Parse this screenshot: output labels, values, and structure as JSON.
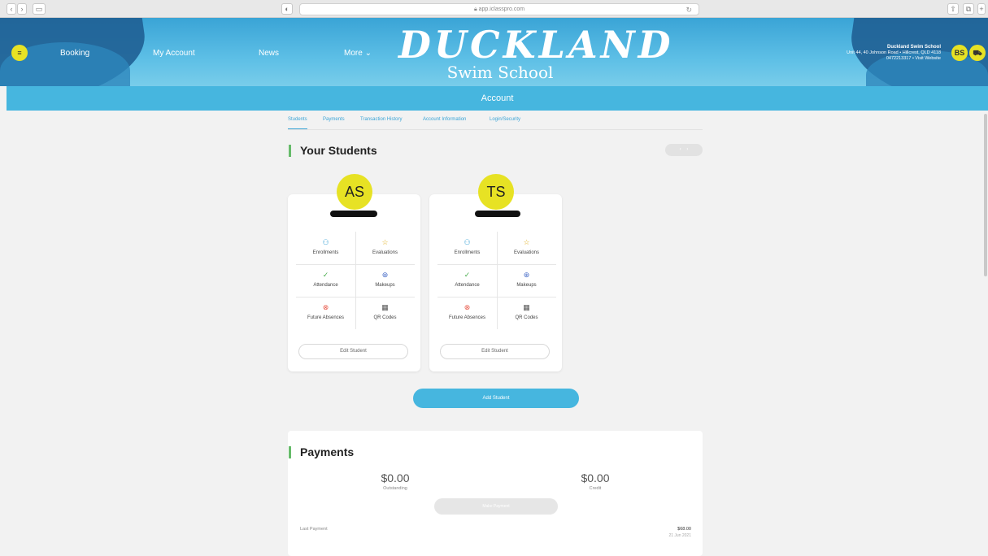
{
  "browser": {
    "url": "app.iclasspro.com"
  },
  "header": {
    "nav": [
      "Booking",
      "My Account",
      "News",
      "More"
    ],
    "more_caret": "⌄",
    "logo_line1": "DUCKLAND",
    "logo_line2": "Swim School",
    "school_name": "Duckland Swim School",
    "school_address": "Unit 44, 40 Johnson Road • Hillcrest, QLD 4118",
    "school_contact": "0472213317 • Visit Website",
    "user_initials": "BS"
  },
  "account_bar": {
    "title": "Account"
  },
  "tabs": [
    "Students",
    "Payments",
    "Transaction History",
    "Account Information",
    "Login/Security"
  ],
  "students_section": {
    "title": "Your Students",
    "pager_prev": "‹",
    "pager_next": "›",
    "cards": [
      {
        "initials": "AS",
        "actions": [
          "Enrollments",
          "Evaluations",
          "Attendance",
          "Makeups",
          "Future Absences",
          "QR Codes"
        ],
        "edit_label": "Edit Student"
      },
      {
        "initials": "TS",
        "actions": [
          "Enrollments",
          "Evaluations",
          "Attendance",
          "Makeups",
          "Future Absences",
          "QR Codes"
        ],
        "edit_label": "Edit Student"
      }
    ],
    "add_label": "Add Student"
  },
  "payments": {
    "title": "Payments",
    "outstanding_value": "$0.00",
    "outstanding_label": "Outstanding",
    "credit_value": "$0.00",
    "credit_label": "Credit",
    "make_payment_label": "Make Payment",
    "last_payment_label": "Last Payment",
    "last_payment_amount": "$68.00",
    "last_payment_date": "21 Jun 2021"
  },
  "icons": {
    "enrollments": "people-icon",
    "evaluations": "star-icon",
    "attendance": "check-circle-icon",
    "makeups": "makeup-icon",
    "future_absences": "x-circle-icon",
    "qr_codes": "qr-code-icon"
  },
  "colors": {
    "accent": "#46b6df",
    "avatar": "#e7e224",
    "section_bar": "#66bb6a"
  }
}
